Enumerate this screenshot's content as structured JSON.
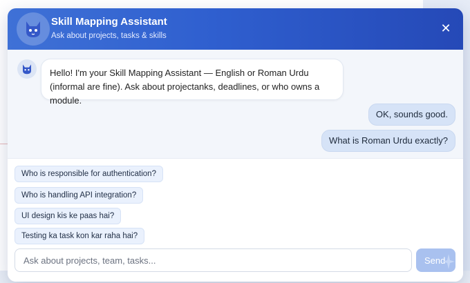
{
  "header": {
    "title": "Skill Mapping Assistant",
    "subtitle": "Ask about projects, tasks & skills",
    "avatar_icon": "cat-bot-icon",
    "close_label": "✕"
  },
  "messages": [
    {
      "role": "bot",
      "text": "Hello! I'm your Skill Mapping Assistant — English or Roman Urdu (informal are fine). Ask about projectanks, deadlines, or who owns a module."
    },
    {
      "role": "user",
      "text": "OK, sounds good."
    },
    {
      "role": "user",
      "text": "What is Roman Urdu exactly?"
    }
  ],
  "suggestions": [
    "Who is responsible for authentication?",
    "Who is handling API integration?",
    "UI design kis ke paas hai?",
    "Testing ka task kon kar raha hai?"
  ],
  "composer": {
    "placeholder": "Ask about projects, team, tasks...",
    "send_label": "Send"
  },
  "colors": {
    "header_gradient_start": "#3f71d6",
    "header_gradient_end": "#2549b7",
    "user_bubble": "#d6e3f7",
    "chip_bg": "#eaf1fd",
    "send_button": "#a9c1ef"
  }
}
